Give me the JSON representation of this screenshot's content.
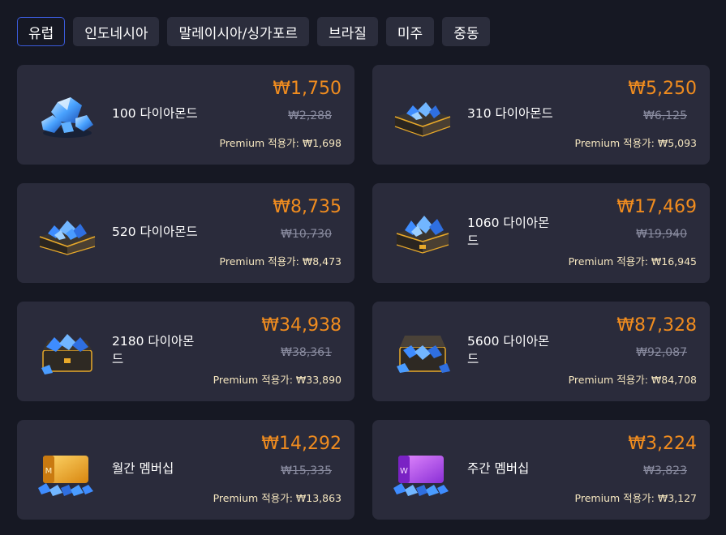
{
  "tabs": [
    {
      "label": "유럽",
      "active": true
    },
    {
      "label": "인도네시아",
      "active": false
    },
    {
      "label": "말레이시아/싱가포르",
      "active": false
    },
    {
      "label": "브라질",
      "active": false
    },
    {
      "label": "미주",
      "active": false
    },
    {
      "label": "중동",
      "active": false
    }
  ],
  "colors": {
    "background": "#161823",
    "card": "#2a2b3b",
    "price": "#f08c1f",
    "premium": "#f5e6bf",
    "active_tab_border": "#3b5bdb"
  },
  "products": [
    {
      "name": "100 다이아몬드",
      "price": "₩1,750",
      "original": "₩2,288",
      "premium_label": "Premium 적용가:",
      "premium_price": "₩1,698",
      "icon": "diamond-pile-icon"
    },
    {
      "name": "310 다이아몬드",
      "price": "₩5,250",
      "original": "₩6,125",
      "premium_label": "Premium 적용가:",
      "premium_price": "₩5,093",
      "icon": "diamond-case-icon"
    },
    {
      "name": "520 다이아몬드",
      "price": "₩8,735",
      "original": "₩10,730",
      "premium_label": "Premium 적용가:",
      "premium_price": "₩8,473",
      "icon": "diamond-case-icon"
    },
    {
      "name": "1060 다이아몬드",
      "price": "₩17,469",
      "original": "₩19,940",
      "premium_label": "Premium 적용가:",
      "premium_price": "₩16,945",
      "icon": "diamond-case-icon"
    },
    {
      "name": "2180 다이아몬드",
      "price": "₩34,938",
      "original": "₩38,361",
      "premium_label": "Premium 적용가:",
      "premium_price": "₩33,890",
      "icon": "diamond-chest-icon"
    },
    {
      "name": "5600 다이아몬드",
      "price": "₩87,328",
      "original": "₩92,087",
      "premium_label": "Premium 적용가:",
      "premium_price": "₩84,708",
      "icon": "diamond-chest-icon"
    },
    {
      "name": "월간 멤버십",
      "price": "₩14,292",
      "original": "₩15,335",
      "premium_label": "Premium 적용가:",
      "premium_price": "₩13,863",
      "icon": "monthly-membership-card-icon"
    },
    {
      "name": "주간 멤버십",
      "price": "₩3,224",
      "original": "₩3,823",
      "premium_label": "Premium 적용가:",
      "premium_price": "₩3,127",
      "icon": "weekly-membership-card-icon"
    }
  ]
}
